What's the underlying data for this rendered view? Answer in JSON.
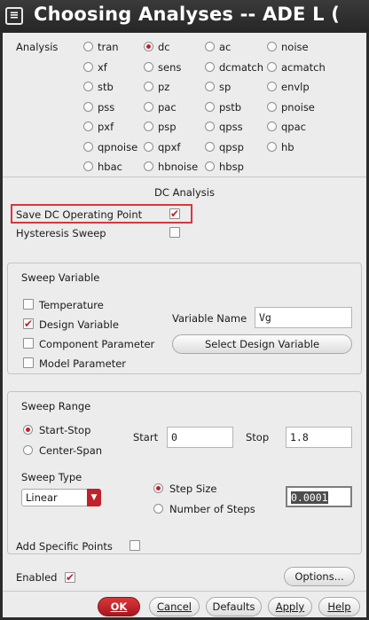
{
  "window": {
    "title": "Choosing Analyses -- ADE L (",
    "icon": "menu-icon"
  },
  "analysis": {
    "label": "Analysis",
    "options": [
      {
        "label": "tran",
        "selected": false
      },
      {
        "label": "dc",
        "selected": true
      },
      {
        "label": "ac",
        "selected": false
      },
      {
        "label": "noise",
        "selected": false
      },
      {
        "label": "xf",
        "selected": false
      },
      {
        "label": "sens",
        "selected": false
      },
      {
        "label": "dcmatch",
        "selected": false
      },
      {
        "label": "acmatch",
        "selected": false
      },
      {
        "label": "stb",
        "selected": false
      },
      {
        "label": "pz",
        "selected": false
      },
      {
        "label": "sp",
        "selected": false
      },
      {
        "label": "envlp",
        "selected": false
      },
      {
        "label": "pss",
        "selected": false
      },
      {
        "label": "pac",
        "selected": false
      },
      {
        "label": "pstb",
        "selected": false
      },
      {
        "label": "pnoise",
        "selected": false
      },
      {
        "label": "pxf",
        "selected": false
      },
      {
        "label": "psp",
        "selected": false
      },
      {
        "label": "qpss",
        "selected": false
      },
      {
        "label": "qpac",
        "selected": false
      },
      {
        "label": "qpnoise",
        "selected": false
      },
      {
        "label": "qpxf",
        "selected": false
      },
      {
        "label": "qpsp",
        "selected": false
      },
      {
        "label": "hb",
        "selected": false
      },
      {
        "label": "hbac",
        "selected": false
      },
      {
        "label": "hbnoise",
        "selected": false
      },
      {
        "label": "hbsp",
        "selected": false
      }
    ]
  },
  "dc": {
    "section_title": "DC Analysis",
    "save_op_label": "Save DC Operating Point",
    "save_op_checked": true,
    "hysteresis_label": "Hysteresis Sweep",
    "hysteresis_checked": false
  },
  "sweep_variable": {
    "title": "Sweep Variable",
    "options": [
      {
        "label": "Temperature",
        "checked": false
      },
      {
        "label": "Design Variable",
        "checked": true
      },
      {
        "label": "Component Parameter",
        "checked": false
      },
      {
        "label": "Model Parameter",
        "checked": false
      }
    ],
    "variable_name_label": "Variable Name",
    "variable_name_value": "Vg",
    "select_button": "Select Design Variable"
  },
  "sweep_range": {
    "title": "Sweep Range",
    "mode_options": [
      {
        "label": "Start-Stop",
        "selected": true
      },
      {
        "label": "Center-Span",
        "selected": false
      }
    ],
    "start_label": "Start",
    "start_value": "0",
    "stop_label": "Stop",
    "stop_value": "1.8",
    "sweep_type_label": "Sweep Type",
    "sweep_type_value": "Linear",
    "step_options": [
      {
        "label": "Step Size",
        "selected": true
      },
      {
        "label": "Number of Steps",
        "selected": false
      }
    ],
    "step_value": "0.0001",
    "add_points_label": "Add Specific Points",
    "add_points_checked": false
  },
  "footer": {
    "enabled_label": "Enabled",
    "enabled_checked": true,
    "options_button": "Options...",
    "ok": "OK",
    "cancel": "Cancel",
    "defaults": "Defaults",
    "apply": "Apply",
    "help": "Help"
  },
  "colors": {
    "accent": "#c0212b",
    "highlight_box": "#d8383a",
    "background": "#ececec",
    "titlebar": "#2b2b2b"
  }
}
